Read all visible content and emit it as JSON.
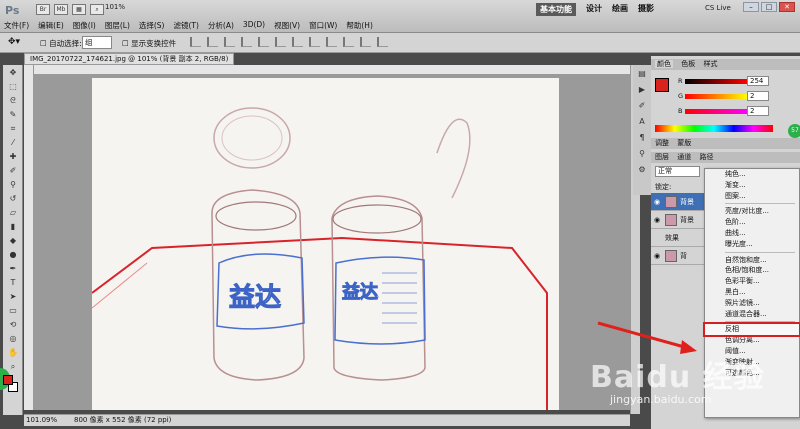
{
  "app": {
    "logo": "Ps",
    "zoom_select": "101%",
    "workspaces": [
      "基本功能",
      "设计",
      "绘画",
      "摄影"
    ],
    "cslive": "CS Live",
    "menus": [
      "文件(F)",
      "编辑(E)",
      "图像(I)",
      "图层(L)",
      "选择(S)",
      "滤镜(T)",
      "分析(A)",
      "3D(D)",
      "视图(V)",
      "窗口(W)",
      "帮助(H)"
    ]
  },
  "options": {
    "auto_select": "自动选择:",
    "group_value": "组",
    "show_transform": "显示变换控件"
  },
  "document": {
    "tab_title": "IMG_20170722_174621.jpg @ 101% (背景 副本 2, RGB/8) *",
    "status_zoom": "101.09%",
    "status_size": "800 像素 x 552 像素 (72 ppi)"
  },
  "color_panel": {
    "tabs": [
      "颜色",
      "色板",
      "样式"
    ],
    "r_label": "R",
    "g_label": "G",
    "b_label": "B",
    "r_value": "254",
    "g_value": "2",
    "b_value": "2",
    "accent": "#d8231f"
  },
  "adjust_panel": {
    "tabs": [
      "调整",
      "蒙版"
    ]
  },
  "layers_panel": {
    "tabs": [
      "图层",
      "通道",
      "路径"
    ],
    "blend_mode": "正常",
    "lock_label": "锁定:",
    "layers": [
      {
        "name": "背景",
        "selected": true
      },
      {
        "name": "背景",
        "selected": false
      },
      {
        "name": "效果",
        "selected": false
      },
      {
        "name": "背",
        "selected": false
      }
    ]
  },
  "context_menu": {
    "items": [
      "纯色...",
      "渐变...",
      "图案...",
      "亮度/对比度...",
      "色阶...",
      "曲线...",
      "曝光度...",
      "自然饱和度...",
      "色相/饱和度...",
      "色彩平衡...",
      "黑白...",
      "照片滤镜...",
      "通道混合器...",
      "反相",
      "色调分离...",
      "阈值...",
      "渐变映射...",
      "可选颜色..."
    ],
    "highlighted": "反相"
  },
  "badge": "57",
  "watermark": "Baidu 经验",
  "watermark_url": "jingyan.baidu.com"
}
